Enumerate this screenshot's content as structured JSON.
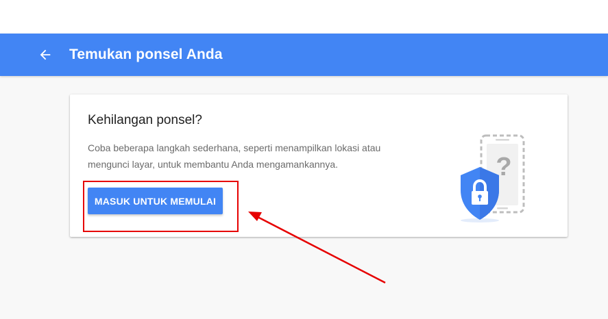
{
  "app_bar": {
    "title": "Temukan ponsel Anda",
    "back_icon": "arrow-left-icon",
    "color": "#4285f4"
  },
  "card": {
    "heading": "Kehilangan ponsel?",
    "description_line1": "Coba beberapa langkah sederhana, seperti menampilkan lokasi atau",
    "description_line2": "mengunci layar, untuk membantu Anda mengamankannya.",
    "button_label": "MASUK UNTUK MEMULAI",
    "illustration_icons": [
      "phone-outline-icon",
      "question-mark-icon",
      "shield-lock-icon"
    ]
  },
  "annotation": {
    "highlight_color": "#e60000"
  }
}
